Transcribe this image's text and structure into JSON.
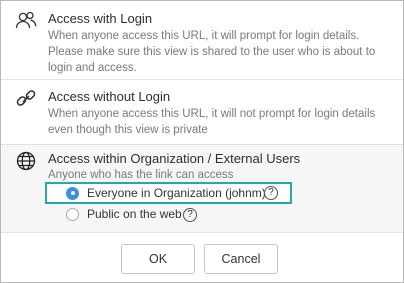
{
  "options": [
    {
      "title": "Access with Login",
      "description": "When anyone access this URL, it will prompt for login details. Please make sure this view is shared to the user who is about to login and access.",
      "icon": "users-icon"
    },
    {
      "title": "Access without Login",
      "description": "When anyone access this URL, it will not prompt for login details even though this view is private",
      "icon": "link-icon"
    },
    {
      "title": "Access within Organization / External Users",
      "description": "Anyone who has the link can access",
      "icon": "globe-icon"
    }
  ],
  "suboptions": [
    {
      "label": "Everyone in Organization (johnm)",
      "selected": true
    },
    {
      "label": "Public on the web",
      "selected": false
    }
  ],
  "help_glyph": "?",
  "buttons": {
    "ok": "OK",
    "cancel": "Cancel"
  },
  "colors": {
    "accent": "#3b8ee8",
    "highlight_border": "#2aa6a8"
  }
}
